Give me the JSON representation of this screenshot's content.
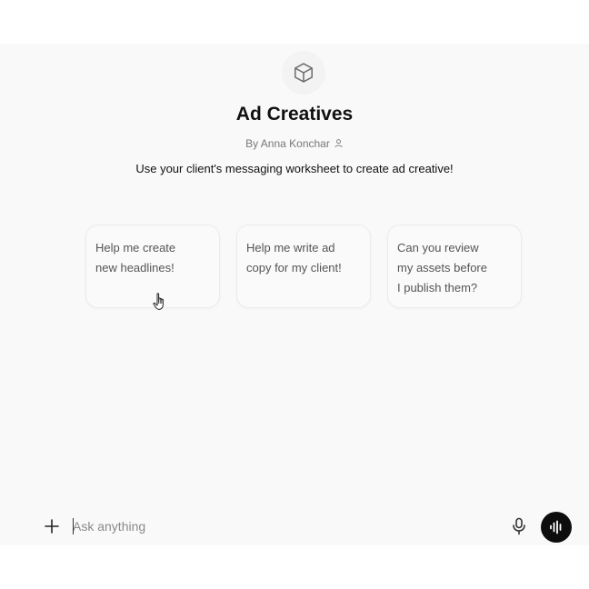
{
  "gpt": {
    "title": "Ad Creatives",
    "author": "By Anna Konchar",
    "description": "Use your client's messaging worksheet to create ad creative!"
  },
  "starters": [
    {
      "lines": [
        "Help me create",
        "new headlines!"
      ]
    },
    {
      "lines": [
        "Help me write ad",
        "copy for my client!"
      ]
    },
    {
      "lines": [
        "Can you review",
        "my assets before",
        "I publish them?"
      ]
    }
  ],
  "composer": {
    "placeholder": "Ask anything",
    "value": ""
  },
  "icons": {
    "logo": "cube-icon",
    "author": "person-icon",
    "attach": "plus-icon",
    "dictate": "microphone-icon",
    "voice": "voice-waveform-icon",
    "cursor": "hand-pointer-icon"
  },
  "colors": {
    "background": "#f9f9f9",
    "voice_button": "#0d0d0d",
    "muted_text": "#777777"
  }
}
